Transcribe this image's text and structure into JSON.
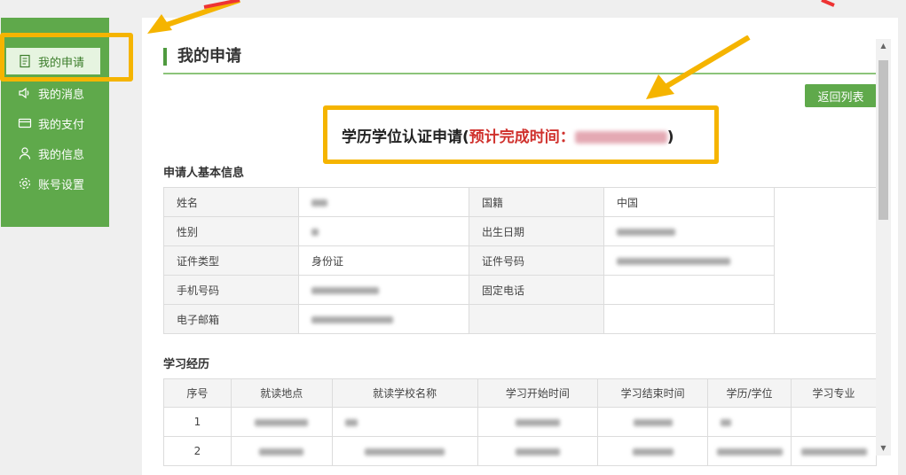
{
  "sidebar": {
    "items": [
      {
        "label": "我的申请",
        "icon": "document-icon"
      },
      {
        "label": "我的消息",
        "icon": "speaker-icon"
      },
      {
        "label": "我的支付",
        "icon": "card-icon"
      },
      {
        "label": "我的信息",
        "icon": "user-icon"
      },
      {
        "label": "账号设置",
        "icon": "gear-icon"
      }
    ],
    "active_index": 0
  },
  "page": {
    "title": "我的申请",
    "back_button": "返回列表"
  },
  "form_heading": {
    "main": "学历学位认证申请(",
    "estimate_label": "预计完成时间：",
    "close": ")"
  },
  "applicant": {
    "section_title": "申请人基本信息",
    "rows": [
      {
        "l1": "姓名",
        "v1": "",
        "l2": "国籍",
        "v2": "中国"
      },
      {
        "l1": "性别",
        "v1": "",
        "l2": "出生日期",
        "v2": ""
      },
      {
        "l1": "证件类型",
        "v1": "身份证",
        "l2": "证件号码",
        "v2": ""
      },
      {
        "l1": "手机号码",
        "v1": "",
        "l2": "固定电话",
        "v2": ""
      },
      {
        "l1": "电子邮箱",
        "v1": "",
        "l2": "",
        "v2": ""
      }
    ]
  },
  "study": {
    "section_title": "学习经历",
    "headers": [
      "序号",
      "就读地点",
      "就读学校名称",
      "学习开始时间",
      "学习结束时间",
      "学历/学位",
      "学习专业"
    ],
    "rows": [
      {
        "no": "1"
      },
      {
        "no": "2"
      }
    ]
  },
  "colors": {
    "sidebar_green": "#5fa94b",
    "highlight": "#f5b400",
    "estimate_red": "#d0312d"
  }
}
